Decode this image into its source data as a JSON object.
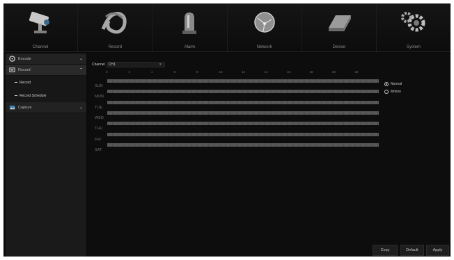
{
  "nav": {
    "items": [
      {
        "label": "Channel",
        "icon": "cctv-camera-icon"
      },
      {
        "label": "Record",
        "icon": "film-reel-icon"
      },
      {
        "label": "Alarm",
        "icon": "alarm-beacon-icon"
      },
      {
        "label": "Network",
        "icon": "globe-network-icon"
      },
      {
        "label": "Device",
        "icon": "hard-drive-icon"
      },
      {
        "label": "System",
        "icon": "gears-icon"
      }
    ]
  },
  "sidebar": {
    "encode": "Encode",
    "record": "Record",
    "record_sub": "Record",
    "record_schedule": "Record Schedule",
    "capture": "Capture"
  },
  "main": {
    "channel_label": "Channel",
    "channel_value": "CH1",
    "hours": [
      "0",
      "2",
      "4",
      "6",
      "8",
      "10",
      "12",
      "14",
      "16",
      "18",
      "20",
      "22"
    ],
    "days": [
      "SUN",
      "MON",
      "TUE",
      "WED",
      "THU",
      "FRI",
      "SAT"
    ],
    "record_types": [
      "Normal",
      "Motion"
    ],
    "selected_type": "Normal",
    "buttons": {
      "copy": "Copy",
      "default": "Default",
      "apply": "Apply"
    }
  },
  "colors": {
    "background": "#0b0b0b",
    "schedule_bar": "#575757",
    "text": "#c8c8c8"
  }
}
